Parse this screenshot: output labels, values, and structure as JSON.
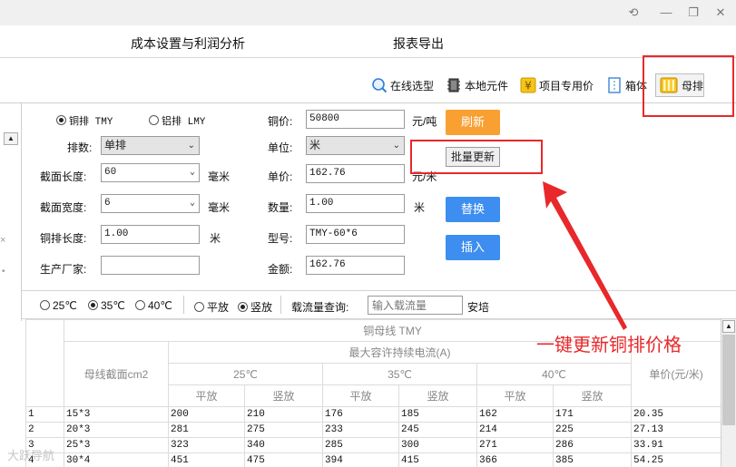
{
  "window_controls": {
    "restore_glyph": "⟲",
    "minimize_glyph": "—",
    "maximize_glyph": "❐",
    "close_glyph": "✕"
  },
  "menu": [
    "成本设置与利润分析",
    "报表导出"
  ],
  "toolbar": {
    "online": "在线选型",
    "local": "本地元件",
    "project": "项目专用价",
    "box": "箱体",
    "busbar": "母排"
  },
  "form": {
    "copper_radio": "铜排 TMY",
    "aluminum_radio": "铝排 LMY",
    "rows_label": "排数:",
    "rows_value": "单排",
    "section_length_label": "截面长度:",
    "section_length_value": "60",
    "section_width_label": "截面宽度:",
    "section_width_value": "6",
    "length_label": "铜排长度:",
    "length_value": "1.00",
    "maker_label": "生产厂家:",
    "maker_value": "",
    "mm1": "毫米",
    "mm2": "毫米",
    "meter_unit": "米",
    "copper_price_label": "铜价:",
    "copper_price_value": "50800",
    "per_ton": "元/吨",
    "unit_label": "单位:",
    "unit_value": "米",
    "unit_price_label": "单价:",
    "unit_price_value": "162.76",
    "per_meter": "元/米",
    "qty_label": "数量:",
    "qty_value": "1.00",
    "qty_unit": "米",
    "model_label": "型号:",
    "model_value": "TMY-60*6",
    "amount_label": "金额:",
    "amount_value": "162.76",
    "refresh": "刷新",
    "batch_update": "批量更新",
    "replace": "替换",
    "insert": "插入"
  },
  "filters": {
    "t25": "25℃",
    "t35": "35℃",
    "t40": "40℃",
    "flat": "平放",
    "vertical": "竖放",
    "query_label": "载流量查询:",
    "query_placeholder": "输入载流量",
    "ampere": "安培"
  },
  "table": {
    "title": "铜母线 TMY",
    "section_header": "母线截面cm2",
    "group_header": "最大容许持续电流(A)",
    "temps": [
      "25℃",
      "35℃",
      "40℃"
    ],
    "flat": "平放",
    "vertical": "竖放",
    "price_header": "单价(元/米)",
    "rows": [
      [
        "1",
        "15*3",
        "200",
        "210",
        "176",
        "185",
        "162",
        "171",
        "20.35"
      ],
      [
        "2",
        "20*3",
        "281",
        "275",
        "233",
        "245",
        "214",
        "225",
        "27.13"
      ],
      [
        "3",
        "25*3",
        "323",
        "340",
        "285",
        "300",
        "271",
        "286",
        "33.91"
      ],
      [
        "4",
        "30*4",
        "451",
        "475",
        "394",
        "415",
        "366",
        "385",
        "54.25"
      ]
    ]
  },
  "annotation": "一键更新铜排价格",
  "watermark": "大跃导航",
  "colors": {
    "annotation_red": "#e8282a",
    "orange_button": "#f9a033",
    "blue_button": "#3d8ef0"
  }
}
